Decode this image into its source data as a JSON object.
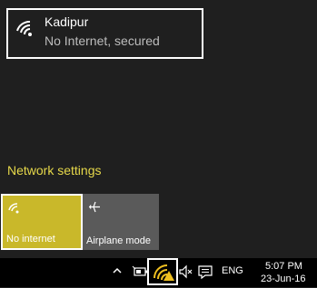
{
  "network": {
    "name": "Kadipur",
    "status": "No Internet, secured"
  },
  "settings_link": "Network settings",
  "quick_actions": [
    {
      "label": "No internet",
      "icon": "wifi-icon",
      "color": "#c9b82a",
      "active": true
    },
    {
      "label": "Airplane mode",
      "icon": "airplane-icon",
      "color": "#5a5a5a",
      "active": false
    }
  ],
  "taskbar": {
    "language": "ENG",
    "time": "5:07 PM",
    "date": "23-Jun-16"
  },
  "colors": {
    "accent": "#c9b82a",
    "link": "#e6d84a",
    "background": "#1f1f1f"
  }
}
